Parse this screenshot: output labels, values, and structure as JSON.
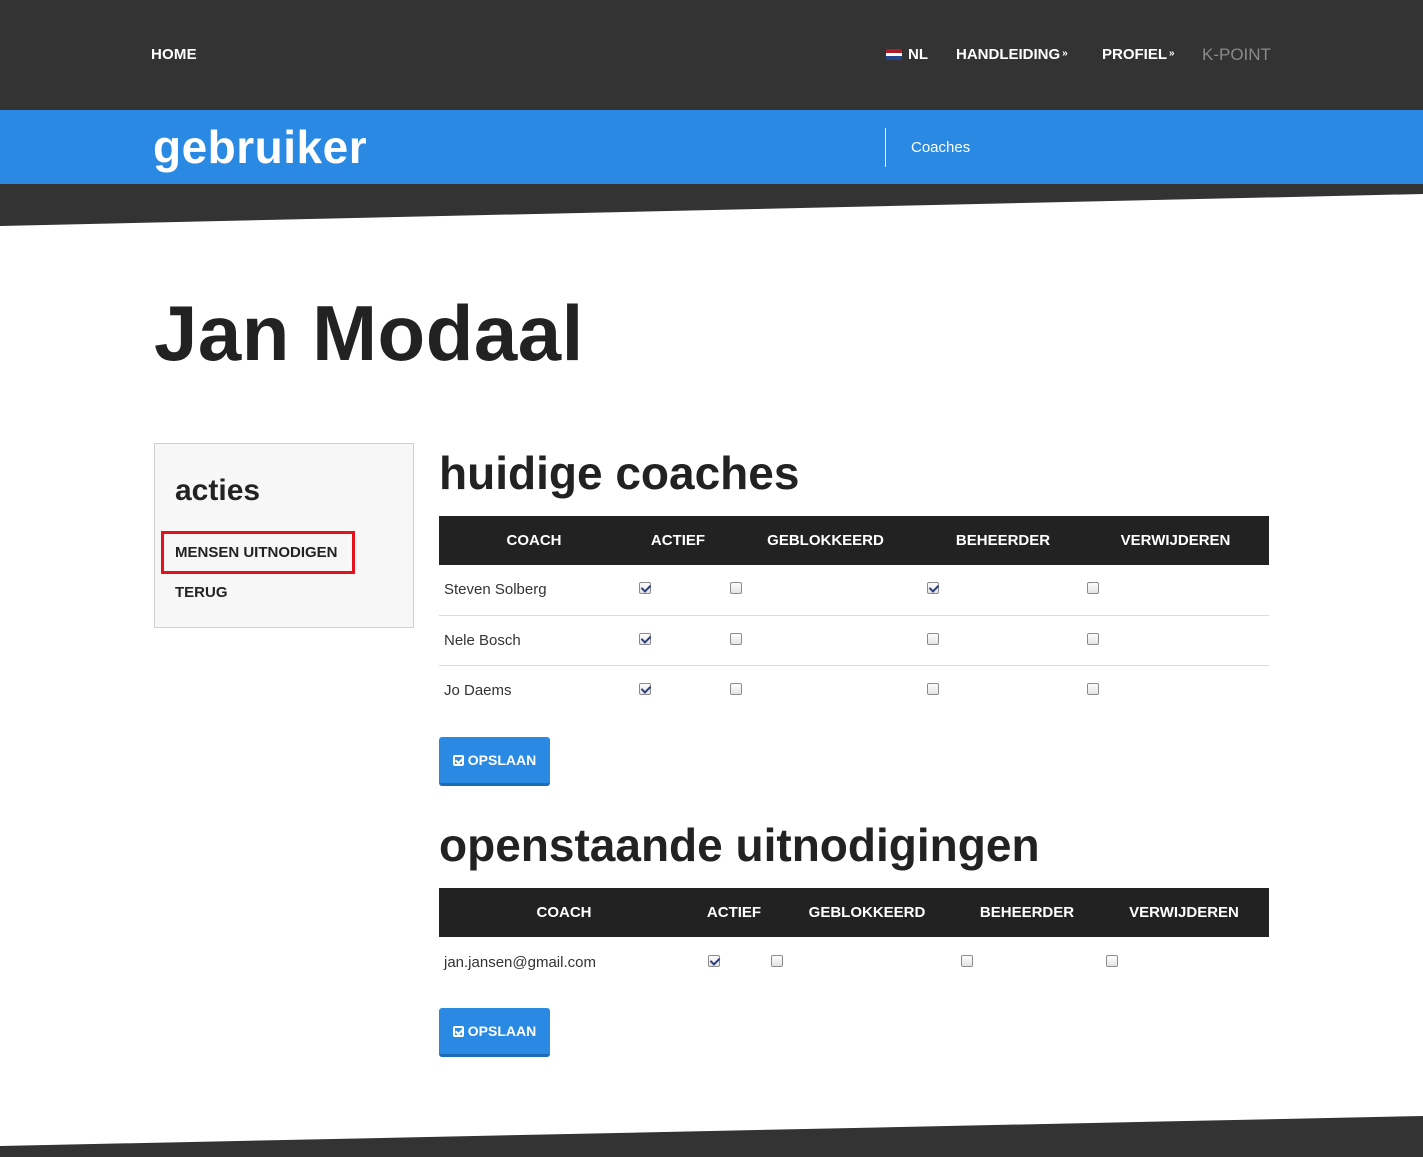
{
  "nav": {
    "home": "HOME",
    "language": "NL",
    "manual": "HANDLEIDING",
    "profile": "PROFIEL",
    "brand": "K-POINT",
    "chevron": "»",
    "flag_colors": [
      "#ae1c28",
      "#ffffff",
      "#21468b"
    ]
  },
  "header": {
    "title": "gebruiker",
    "breadcrumb": "Coaches"
  },
  "page": {
    "title": "Jan Modaal"
  },
  "sidebar": {
    "title": "acties",
    "items": [
      {
        "label": "MENSEN UITNODIGEN"
      },
      {
        "label": "TERUG"
      }
    ]
  },
  "current_coaches": {
    "title": "huidige coaches",
    "columns": [
      "COACH",
      "ACTIEF",
      "GEBLOKKEERD",
      "BEHEERDER",
      "VERWIJDEREN"
    ],
    "rows": [
      {
        "name": "Steven Solberg",
        "actief": true,
        "geblokkeerd": false,
        "beheerder": true,
        "verwijderen": false
      },
      {
        "name": "Nele Bosch",
        "actief": true,
        "geblokkeerd": false,
        "beheerder": false,
        "verwijderen": false
      },
      {
        "name": "Jo Daems",
        "actief": true,
        "geblokkeerd": false,
        "beheerder": false,
        "verwijderen": false
      }
    ],
    "save_label": "OPSLAAN"
  },
  "pending_invitations": {
    "title": "openstaande uitnodigingen",
    "columns": [
      "COACH",
      "ACTIEF",
      "GEBLOKKEERD",
      "BEHEERDER",
      "VERWIJDEREN"
    ],
    "rows": [
      {
        "name": "jan.jansen@gmail.com",
        "actief": true,
        "geblokkeerd": false,
        "beheerder": false,
        "verwijderen": false
      }
    ],
    "save_label": "OPSLAAN"
  },
  "colors": {
    "nav_bg": "#333333",
    "accent_blue": "#2a8ae3",
    "table_header": "#222222",
    "highlight": "#e3121c"
  }
}
